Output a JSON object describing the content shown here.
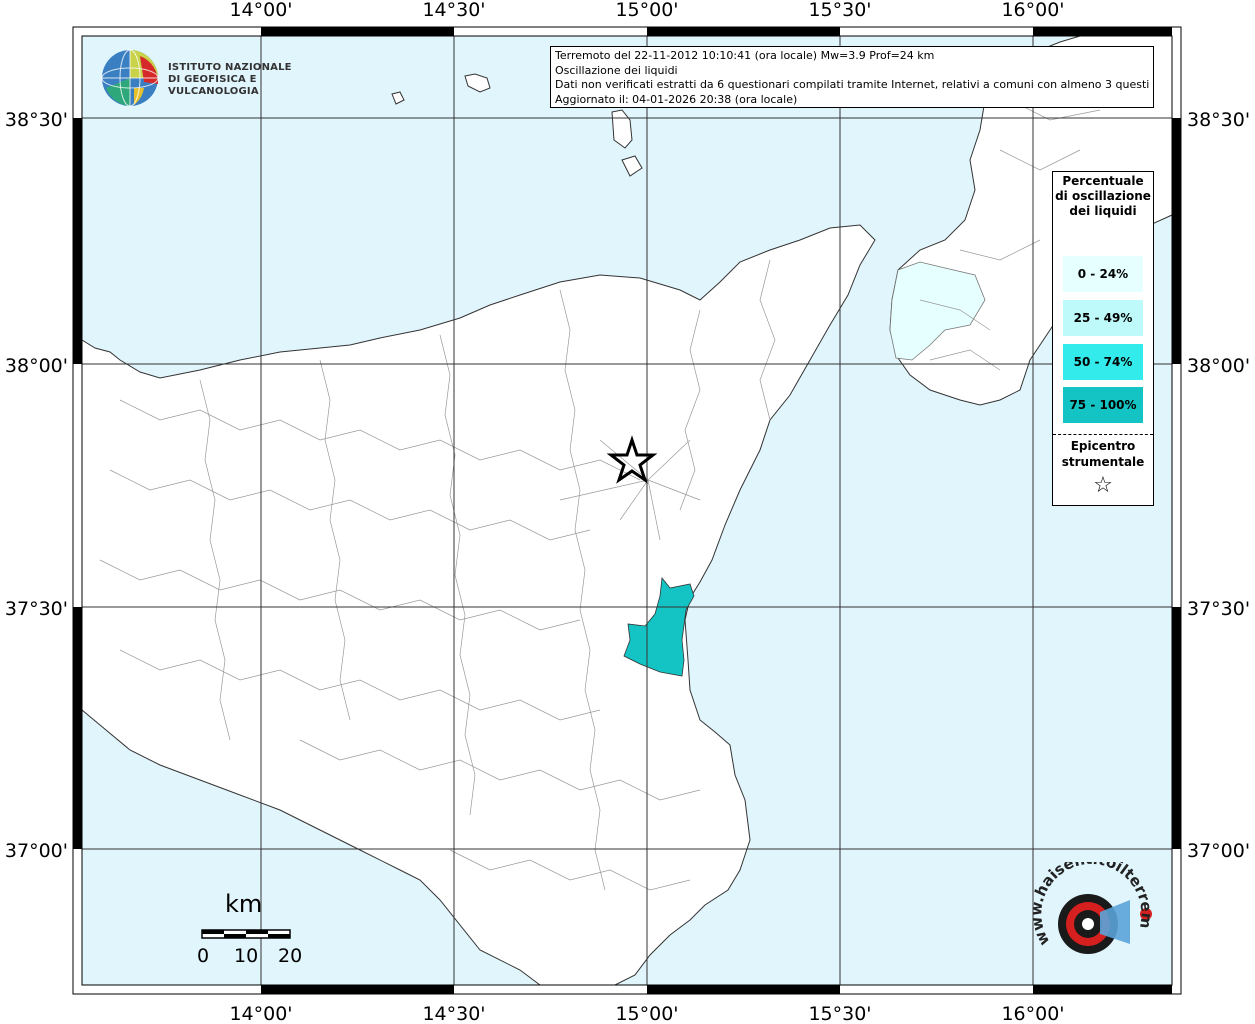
{
  "info": {
    "line1": "Terremoto del 22-11-2012 10:10:41 (ora locale) Mw=3.9 Prof=24 km",
    "line2": "Oscillazione dei liquidi",
    "line3": "Dati non verificati estratti da 6 questionari compilati tramite Internet, relativi a comuni con almeno 3 questionari.",
    "line4": "Aggiornato il: 04-01-2026 20:38 (ora locale)"
  },
  "ingv": {
    "line1": "ISTITUTO NAZIONALE",
    "line2": "DI GEOFISICA E VULCANOLOGIA"
  },
  "legend": {
    "title": "Percentuale di oscillazione dei liquidi",
    "items": [
      {
        "label": "0 - 24%",
        "color": "#e6ffff"
      },
      {
        "label": "25 - 49%",
        "color": "#bffafa"
      },
      {
        "label": "50 - 74%",
        "color": "#33ebeb"
      },
      {
        "label": "75 - 100%",
        "color": "#14c4c4"
      }
    ],
    "epicenter_label": "Epicentro strumentale",
    "epicenter_symbol": "☆"
  },
  "axes": {
    "lon_labels": [
      "14°00'",
      "14°30'",
      "15°00'",
      "15°30'",
      "16°00'"
    ],
    "lat_labels": [
      "38°30'",
      "38°00'",
      "37°30'",
      "37°00'"
    ]
  },
  "scale": {
    "unit": "km",
    "labels": [
      "0",
      "10",
      "20"
    ]
  },
  "watermark": {
    "text": "www.haisentitoilterremoto.it"
  },
  "colors": {
    "sea": "#e1f5fd",
    "land": "#ffffff",
    "highlight": "#14c4c4"
  }
}
